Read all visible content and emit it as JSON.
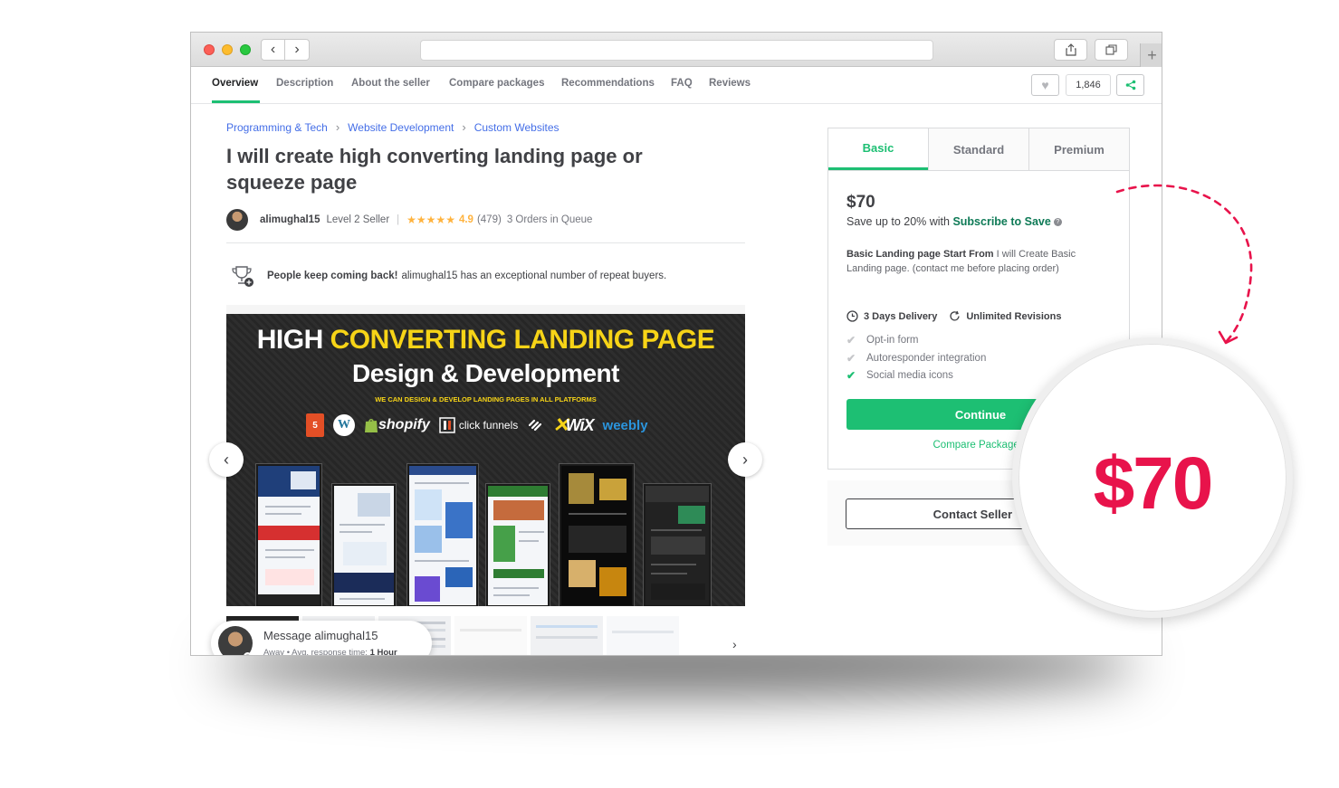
{
  "nav": {
    "tabs": [
      "Overview",
      "Description",
      "About the seller",
      "Compare packages",
      "Recommendations",
      "FAQ",
      "Reviews"
    ],
    "like_count": "1,846"
  },
  "breadcrumb": [
    "Programming & Tech",
    "Website Development",
    "Custom Websites"
  ],
  "gig": {
    "title": "I will create high converting landing page or squeeze page",
    "seller": "alimughal15",
    "level": "Level 2 Seller",
    "stars": "★★★★★",
    "rating": "4.9",
    "reviews": "(479)",
    "queue": "3 Orders in Queue",
    "repeat_bold": "People keep coming back!",
    "repeat_text": "alimughal15 has an exceptional number of repeat buyers."
  },
  "gallery": {
    "headline_white": "HIGH ",
    "headline_yellow": "CONVERTING LANDING PAGE",
    "headline2": "Design & Development",
    "tagline": "WE CAN DESIGN & DEVELOP LANDING PAGES IN ALL PLATFORMS",
    "logos": {
      "html5": "5",
      "html_label": "HTML",
      "wordpress": "W",
      "shopify": "shopify",
      "clickfunnels": "click funnels",
      "wix": "WiX",
      "weebly": "weebly"
    }
  },
  "message": {
    "title": "Message alimughal15",
    "status": "Away",
    "response_label": "Avg. response time:",
    "response_value": "1 Hour"
  },
  "package": {
    "tabs": [
      "Basic",
      "Standard",
      "Premium"
    ],
    "price": "$70",
    "save_prefix": "Save up to 20% with ",
    "save_link": "Subscribe to Save",
    "qmark": "?",
    "desc_bold": "Basic Landing page Start From",
    "desc_text": " I will Create Basic Landing page. (contact me before placing order)",
    "delivery": "3 Days Delivery",
    "revisions": "Unlimited Revisions",
    "features": [
      {
        "label": "Opt-in form",
        "included": false
      },
      {
        "label": "Autoresponder integration",
        "included": false
      },
      {
        "label": "Social media icons",
        "included": true
      }
    ],
    "check_glyph": "✔",
    "continue": "Continue",
    "compare": "Compare Packages",
    "contact": "Contact Seller",
    "contact_chevron": "⌄"
  },
  "callout": {
    "price": "$70",
    "accent_color": "#e8134b"
  },
  "colors": {
    "brand_green": "#1dbf73",
    "link_blue": "#446ee7",
    "star": "#ffb33e"
  }
}
